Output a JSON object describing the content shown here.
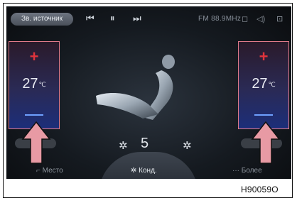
{
  "top_bar": {
    "source_label": "Зв. источник",
    "prev_icon": "⏮",
    "pause_icon": "⏸",
    "next_icon": "⏭",
    "radio": "FM 88.9MHz",
    "icon_right_1": "◻",
    "icon_right_2": "◁)",
    "icon_right_3": "⊡"
  },
  "left_temp": {
    "plus": "+",
    "value": "27",
    "unit": "℃"
  },
  "right_temp": {
    "plus": "+",
    "value": "27",
    "unit": "℃"
  },
  "fan": {
    "speed": "5",
    "icon": "✲"
  },
  "bottom": {
    "left": "Место",
    "center": "Конд.",
    "right": "Более"
  },
  "figure_code": "H90059O",
  "colors": {
    "highlight": "#e07a8a",
    "arrow": "#e89aa4",
    "plus": "#e0343c"
  }
}
